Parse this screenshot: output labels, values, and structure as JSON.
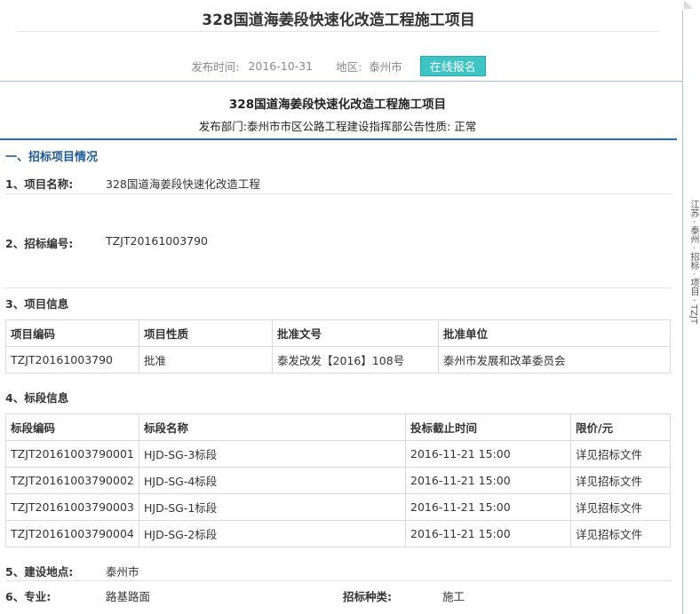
{
  "header": {
    "title": "328国道海姜段快速化改造工程施工项目",
    "publish_label": "发布时间:",
    "publish_date": "2016-10-31",
    "region_label": "地区:",
    "region": "泰州市",
    "signup_label": "在线报名"
  },
  "side_text": "江苏 · 泰州 · 招标 · 项目 · TZJT",
  "panel": {
    "title": "328国道海姜段快速化改造工程施工项目",
    "subtitle": "发布部门:泰州市市区公路工程建设指挥部公告性质: 正常",
    "section1": "一、招标项目情况",
    "item1_label": "1、项目名称:",
    "item1_value": "328国道海姜段快速化改造工程",
    "item2_label": "2、招标编号:",
    "item2_value": "TZJT20161003790",
    "item3_label": "3、项目信息",
    "info_headers": [
      "项目编码",
      "项目性质",
      "批准文号",
      "批准单位"
    ],
    "info_row": [
      "TZJT20161003790",
      "批准",
      "泰发改发【2016】108号",
      "泰州市发展和改革委员会"
    ],
    "item4_label": "4、标段信息",
    "lot_headers": [
      "标段编码",
      "标段名称",
      "投标截止时间",
      "限价/元"
    ],
    "lots": [
      [
        "TZJT20161003790001",
        "HJD-SG-3标段",
        "2016-11-21 15:00",
        "详见招标文件"
      ],
      [
        "TZJT20161003790002",
        "HJD-SG-4标段",
        "2016-11-21 15:00",
        "详见招标文件"
      ],
      [
        "TZJT20161003790003",
        "HJD-SG-1标段",
        "2016-11-21 15:00",
        "详见招标文件"
      ],
      [
        "TZJT20161003790004",
        "HJD-SG-2标段",
        "2016-11-21 15:00",
        "详见招标文件"
      ]
    ],
    "item5_label": "5、建设地点:",
    "item5_value": "泰州市",
    "item6_label": "6、专业:",
    "item6_value": "路基路面",
    "item6b_label": "招标种类:",
    "item6b_value": "施工"
  }
}
